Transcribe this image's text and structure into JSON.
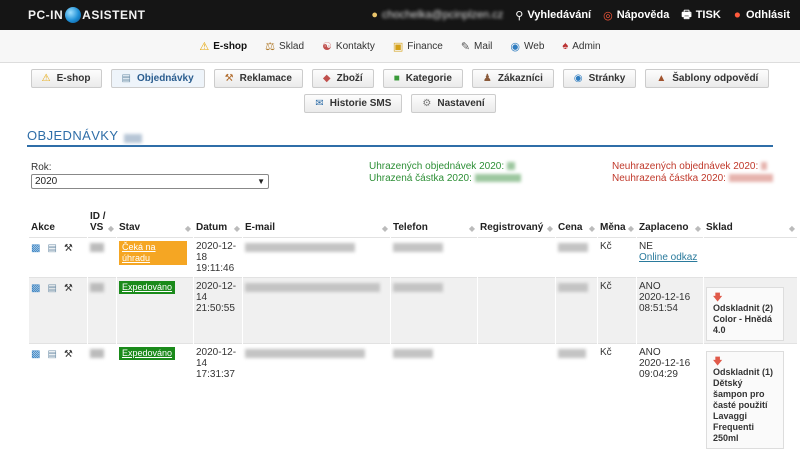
{
  "brand": {
    "left": "PC-IN",
    "right": "ASISTENT"
  },
  "topbar": {
    "items": [
      {
        "icon": "search-icon",
        "label": "Vyhledávání"
      },
      {
        "icon": "help-icon",
        "label": "Nápověda"
      },
      {
        "icon": "print-icon",
        "label": "TISK"
      },
      {
        "icon": "logout-icon",
        "label": "Odhlásit"
      }
    ],
    "blurred_email": "chochelka@pcinplzen.cz"
  },
  "mainnav": [
    {
      "label": "E-shop",
      "icon": "bell-icon"
    },
    {
      "label": "Sklad",
      "icon": "scales-icon"
    },
    {
      "label": "Kontakty",
      "icon": "contacts-icon"
    },
    {
      "label": "Finance",
      "icon": "money-icon"
    },
    {
      "label": "Mail",
      "icon": "pen-icon"
    },
    {
      "label": "Web",
      "icon": "globe-icon"
    },
    {
      "label": "Admin",
      "icon": "admin-icon"
    }
  ],
  "subnav": [
    {
      "label": "E-shop",
      "icon": "bell-icon"
    },
    {
      "label": "Objednávky",
      "icon": "list-icon"
    },
    {
      "label": "Reklamace",
      "icon": "hammer-icon"
    },
    {
      "label": "Zboží",
      "icon": "product-icon"
    },
    {
      "label": "Kategorie",
      "icon": "category-icon"
    },
    {
      "label": "Zákazníci",
      "icon": "customers-icon"
    },
    {
      "label": "Stránky",
      "icon": "pages-icon"
    },
    {
      "label": "Šablony odpovědí",
      "icon": "template-icon"
    },
    {
      "label": "Historie SMS",
      "icon": "sms-icon"
    },
    {
      "label": "Nastavení",
      "icon": "gear-icon"
    }
  ],
  "page": {
    "title": "OBJEDNÁVKY"
  },
  "filter": {
    "label": "Rok:",
    "value": "2020"
  },
  "stats": {
    "paid_count_label": "Uhrazených objednávek 2020:",
    "paid_sum_label": "Uhrazená částka 2020:",
    "unpaid_count_label": "Neuhrazených objednávek 2020:",
    "unpaid_sum_label": "Neuhrazená částka 2020:"
  },
  "table": {
    "headers": {
      "akce": "Akce",
      "id": "ID / VS",
      "stav": "Stav",
      "datum": "Datum",
      "email": "E-mail",
      "telefon": "Telefon",
      "registrovany": "Registrovaný",
      "cena": "Cena",
      "mena": "Měna",
      "zaplaceno": "Zaplaceno",
      "sklad": "Sklad"
    },
    "rows": [
      {
        "stav": "Čeká na úhradu",
        "datum": "2020-12-18 19:11:46",
        "mena": "Kč",
        "zaplaceno": "NE",
        "zaplaceno_link": "Online odkaz",
        "zaplaceno_date": "",
        "sklad": ""
      },
      {
        "stav": "Expedováno",
        "datum": "2020-12-14 21:50:55",
        "mena": "Kč",
        "zaplaceno": "ANO",
        "zaplaceno_link": "",
        "zaplaceno_date": "2020-12-16 08:51:54",
        "sklad": "Odskladnit (2) Color - Hnědá 4.0"
      },
      {
        "stav": "Expedováno",
        "datum": "2020-12-14 17:31:37",
        "mena": "Kč",
        "zaplaceno": "ANO",
        "zaplaceno_link": "",
        "zaplaceno_date": "2020-12-16 09:04:29",
        "sklad": "Odskladnit (1) Dětský šampon pro časté použití Lavaggi Frequenti 250ml"
      }
    ]
  },
  "colors": {
    "accent": "#2f6ea8",
    "paid": "#2d8f36",
    "unpaid": "#c0392b",
    "pending": "#f5a623",
    "shipped": "#1a8a1a"
  }
}
